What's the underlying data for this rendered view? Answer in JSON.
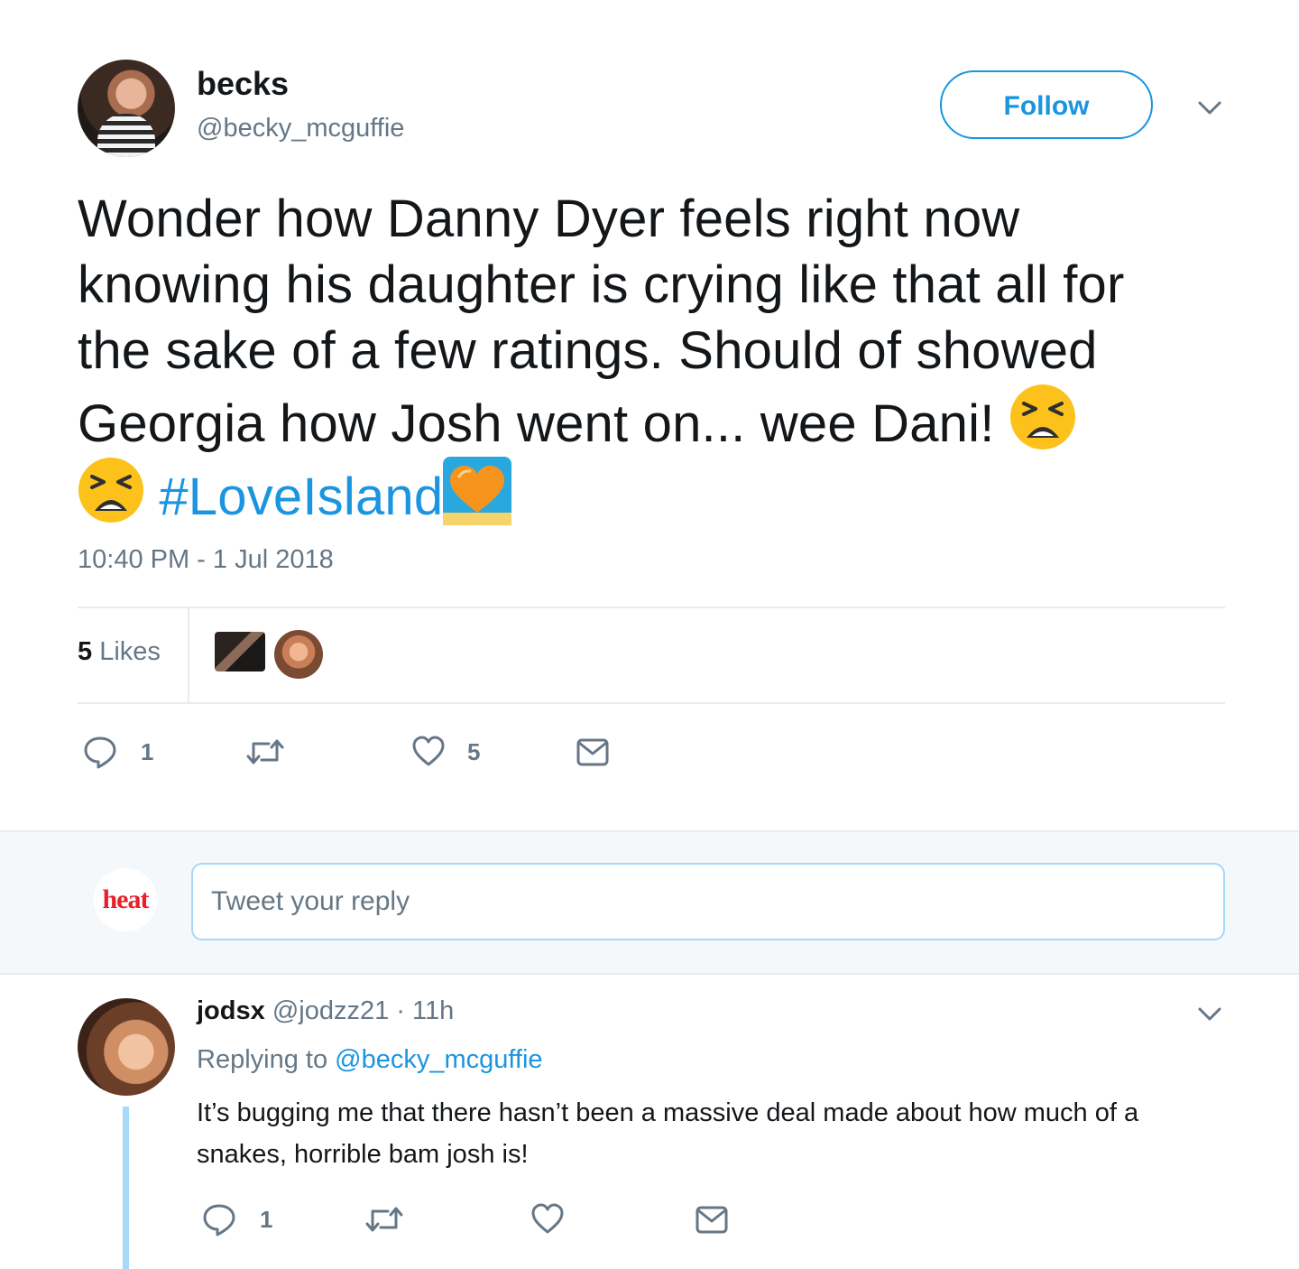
{
  "tweet": {
    "author_name": "becks",
    "author_handle": "@becky_mcguffie",
    "follow_label": "Follow",
    "text_line1": "Wonder how Danny Dyer feels right now",
    "text_line2": "knowing his daughter is crying like that all for",
    "text_line3": "the sake of a few ratings. Should of showed",
    "text_line4": "Georgia how Josh went on... wee Dani! ",
    "hashtag": "#LoveIsland",
    "timestamp": "10:40 PM - 1 Jul 2018",
    "likes_count": "5",
    "likes_label": " Likes",
    "reply_count": "1",
    "like_count": "5",
    "icons": [
      "reply-icon",
      "retweet-icon",
      "heart-icon",
      "direct-message-icon",
      "tired-face-emoji",
      "orange-heart-emoji",
      "chevron-down-icon"
    ]
  },
  "compose": {
    "avatar_text": "heat",
    "placeholder": "Tweet your reply"
  },
  "reply": {
    "author_name": "jodsx",
    "author_handle": "@jodzz21",
    "time": " · 11h",
    "replying_label": "Replying to ",
    "replying_handle": "@becky_mcguffie",
    "text": "It’s bugging me that there hasn’t been a massive deal made about how much of a snakes, horrible bam josh is!",
    "reply_count": "1"
  },
  "colors": {
    "accent": "#1b95e0",
    "muted": "#657786",
    "divider": "#e6ecf0",
    "thread": "#a4d9f9",
    "heat_red": "#e8202a"
  }
}
